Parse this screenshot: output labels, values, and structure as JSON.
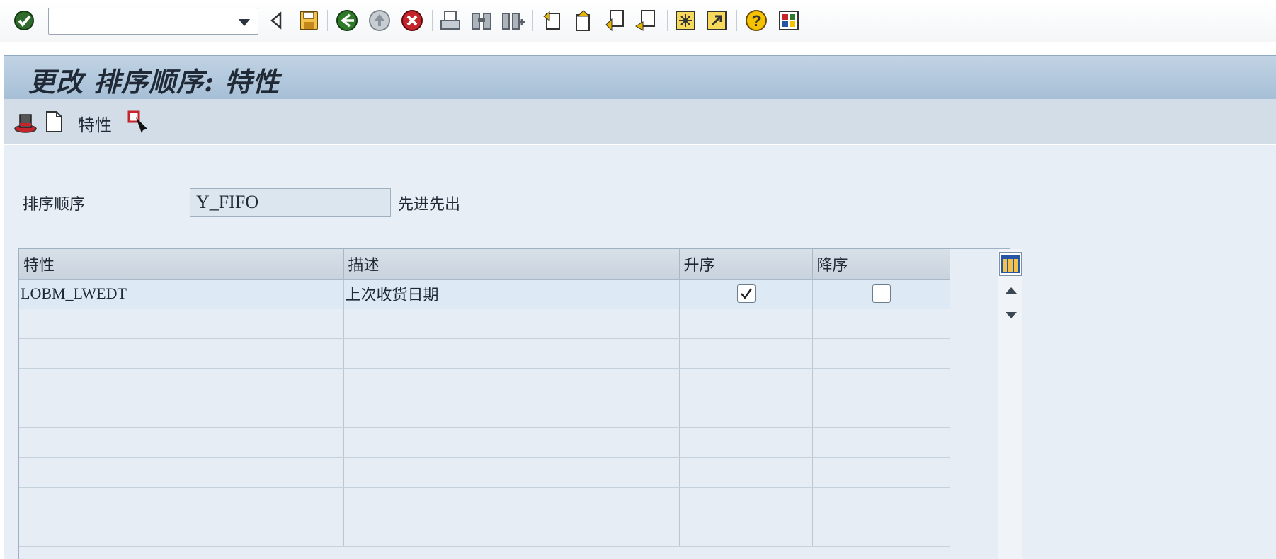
{
  "toolbar": {
    "command_field_value": "",
    "icons": [
      "enter-icon",
      "back-icon",
      "save-icon",
      "back-green-icon",
      "exit-icon",
      "cancel-icon",
      "print-icon",
      "find-icon",
      "find-next-icon",
      "first-page-icon",
      "prev-page-icon",
      "next-page-icon",
      "last-page-icon",
      "create-session-icon",
      "shortcut-icon",
      "help-icon",
      "customize-layout-icon"
    ]
  },
  "title": "更改 排序顺序: 特性",
  "app_toolbar": {
    "button_text": "特性",
    "icons": [
      "hat-icon",
      "new-document-icon",
      "select-cursor-icon"
    ]
  },
  "form": {
    "sort_label": "排序顺序",
    "sort_value": "Y_FIFO",
    "sort_desc": "先进先出"
  },
  "table": {
    "columns": [
      "特性",
      "描述",
      "升序",
      "降序"
    ],
    "rows": [
      {
        "characteristic": "LOBM_LWEDT",
        "description": "上次收货日期",
        "ascending": true,
        "descending": false
      }
    ],
    "empty_rows": 8
  },
  "colors": {
    "titlebar": "#b4c8dc",
    "content_bg": "#e8eef5",
    "table_header": "#cfd8e1"
  }
}
